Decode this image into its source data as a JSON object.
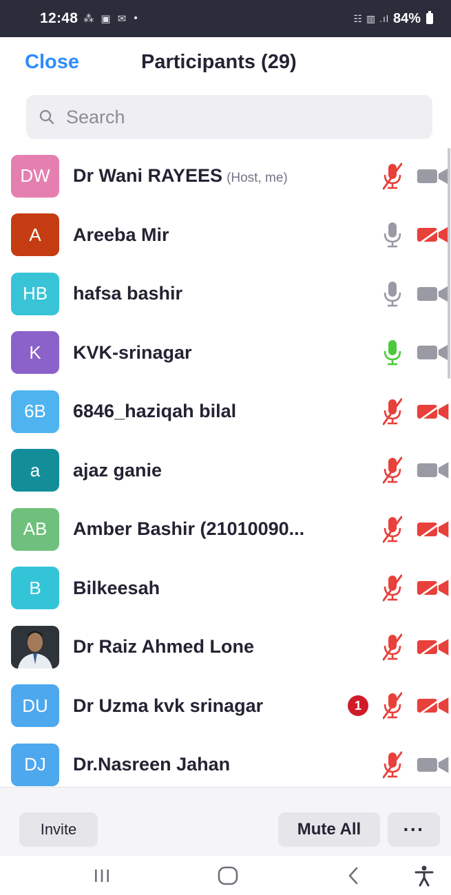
{
  "status_bar": {
    "time": "12:48",
    "notification_icons": "⁂ ▣ ✉",
    "dot": "•",
    "signal": "☷ ▥ .ıl",
    "battery": "84%"
  },
  "header": {
    "close_label": "Close",
    "title": "Participants (29)"
  },
  "search": {
    "placeholder": "Search",
    "value": ""
  },
  "participants": [
    {
      "initials": "DW",
      "name": "Dr Wani RAYEES",
      "role": "(Host, me)",
      "color": "#e57fb0",
      "mic": "muted",
      "video": "on",
      "badge": ""
    },
    {
      "initials": "A",
      "name": "Areeba Mir",
      "role": "",
      "color": "#c53c12",
      "mic": "unmuted",
      "video": "off",
      "badge": ""
    },
    {
      "initials": "HB",
      "name": "hafsa bashir",
      "role": "",
      "color": "#38c4d6",
      "mic": "unmuted",
      "video": "on",
      "badge": ""
    },
    {
      "initials": "K",
      "name": "KVK-srinagar",
      "role": "",
      "color": "#8a62c9",
      "mic": "speaking",
      "video": "on",
      "badge": ""
    },
    {
      "initials": "6B",
      "name": "6846_haziqah bilal",
      "role": "",
      "color": "#4fb3f0",
      "mic": "muted",
      "video": "off",
      "badge": ""
    },
    {
      "initials": "a",
      "name": "ajaz ganie",
      "role": "",
      "color": "#138e99",
      "mic": "muted",
      "video": "on",
      "badge": ""
    },
    {
      "initials": "AB",
      "name": "Amber Bashir (21010090...",
      "role": "",
      "color": "#6fc07c",
      "mic": "muted",
      "video": "off",
      "badge": ""
    },
    {
      "initials": "B",
      "name": "Bilkeesah",
      "role": "",
      "color": "#34c4d8",
      "mic": "muted",
      "video": "off",
      "badge": ""
    },
    {
      "initials": "",
      "name": "Dr Raiz Ahmed Lone",
      "role": "",
      "color": "#3b3f46",
      "photo": true,
      "mic": "muted",
      "video": "off",
      "badge": ""
    },
    {
      "initials": "DU",
      "name": "Dr Uzma kvk srinagar",
      "role": "",
      "color": "#4ea8ee",
      "mic": "muted",
      "video": "off",
      "badge": "1"
    },
    {
      "initials": "DJ",
      "name": "Dr.Nasreen Jahan",
      "role": "",
      "color": "#4ea8ee",
      "mic": "muted",
      "video": "on",
      "badge": ""
    }
  ],
  "footer": {
    "invite_label": "Invite",
    "mute_all_label": "Mute All",
    "more_label": "···"
  },
  "colors": {
    "accent": "#2d8cff",
    "muted_red": "#e8403a",
    "speaking_green": "#4cc93c",
    "neutral_gray": "#9a9aa5"
  }
}
